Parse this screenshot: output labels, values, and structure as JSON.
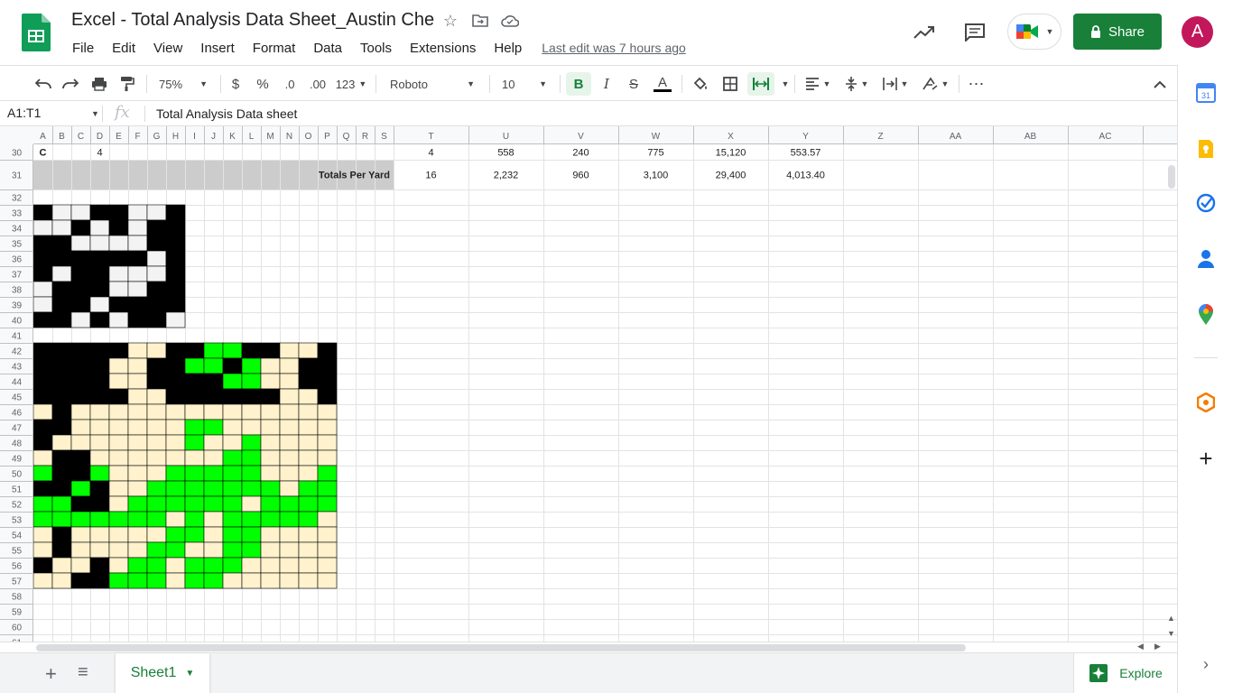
{
  "app": {
    "doc_title": "Excel - Total Analysis Data Sheet_Austin Che",
    "menu": [
      "File",
      "Edit",
      "View",
      "Insert",
      "Format",
      "Data",
      "Tools",
      "Extensions",
      "Help"
    ],
    "last_edit": "Last edit was 7 hours ago",
    "share_label": "Share",
    "avatar_letter": "A",
    "brand_color": "#188038"
  },
  "toolbar": {
    "zoom": "75%",
    "currency": "$",
    "percent": "%",
    "decrease_decimal": ".0",
    "increase_decimal": ".00",
    "number_format": "123",
    "font": "Roboto",
    "font_size": "10",
    "bold": "B",
    "italic": "I",
    "strike": "S",
    "text_color": "A"
  },
  "formula_bar": {
    "name_box": "A1:T1",
    "fx": "fx",
    "value": "Total Analysis Data sheet"
  },
  "grid": {
    "narrow_columns": [
      "A",
      "B",
      "C",
      "D",
      "E",
      "F",
      "G",
      "H",
      "I",
      "J",
      "K",
      "L",
      "M",
      "N",
      "O",
      "P",
      "Q",
      "R",
      "S"
    ],
    "wide_columns": [
      "T",
      "U",
      "V",
      "W",
      "X",
      "Y",
      "Z",
      "AA",
      "AB",
      "AC"
    ],
    "row_numbers": [
      "30",
      "31",
      "32",
      "33",
      "34",
      "35",
      "36",
      "37",
      "38",
      "39",
      "40",
      "41",
      "42",
      "43",
      "44",
      "45",
      "46",
      "47",
      "48",
      "49",
      "50",
      "51",
      "52",
      "53",
      "54",
      "55",
      "56",
      "57",
      "58",
      "59",
      "60",
      "61"
    ],
    "row30": {
      "A": "C",
      "D": "4",
      "T": "4",
      "U": "558",
      "V": "240",
      "W": "775",
      "X": "15,120",
      "Y": "553.57"
    },
    "row31": {
      "label": "Totals Per Yard",
      "T": "16",
      "U": "2,232",
      "V": "960",
      "W": "3,100",
      "X": "29,400",
      "Y": "4,013.40"
    },
    "colors": {
      "black": "#000000",
      "white_cell": "#f3f3f3",
      "green": "#00ff00",
      "cream": "#fff2cc",
      "totals_bg": "#cccccc",
      "gridline": "#e2e3e3",
      "header_bg": "#f8f9fa"
    },
    "pattern1_first_row": 33,
    "pattern1": [
      "KWWKKWWK",
      "WWKWKWKK",
      "KKWWWWKK",
      "KKKKKKWK",
      "KWKKWWWK",
      "WKKKWWKK",
      "WKKWKKKK",
      "KKWKWKKW"
    ],
    "pattern2_first_row": 42,
    "pattern2": [
      "KKKKKCCKKGGKKCCK",
      "KKKKCCKKGGKGCCKK",
      "KKKKCCKKKKGGCCKK",
      "KKKKKCCKKKKKKCCK",
      "CKCCCCCCCCCCCCCC",
      "KKCCCCCCGGCCCCCC",
      "KCCCCCCCGCCGCCCC",
      "CKKCCCCCCCGGCCCC",
      "GKKGCCCGGGGGCCCG",
      "KKGKCCGGGGGGGCGG",
      "GGKKCGGGGGGCGGGG",
      "GGGGGGGCGCGGGGGC",
      "CKCCCCCGGCGGCCCC",
      "CKCCCCGGCCGGCCCC",
      "KCCKCGGCGGGCCCCC",
      "CCKKGGGCGGCCCCCC"
    ]
  },
  "sheet_tabs": {
    "active": "Sheet1",
    "explore_label": "Explore"
  },
  "side_panel": {
    "icons": [
      "calendar-icon",
      "keep-icon",
      "tasks-icon",
      "contacts-icon",
      "maps-icon",
      "addon-icon",
      "add-icon"
    ],
    "calendar_day": "31"
  }
}
